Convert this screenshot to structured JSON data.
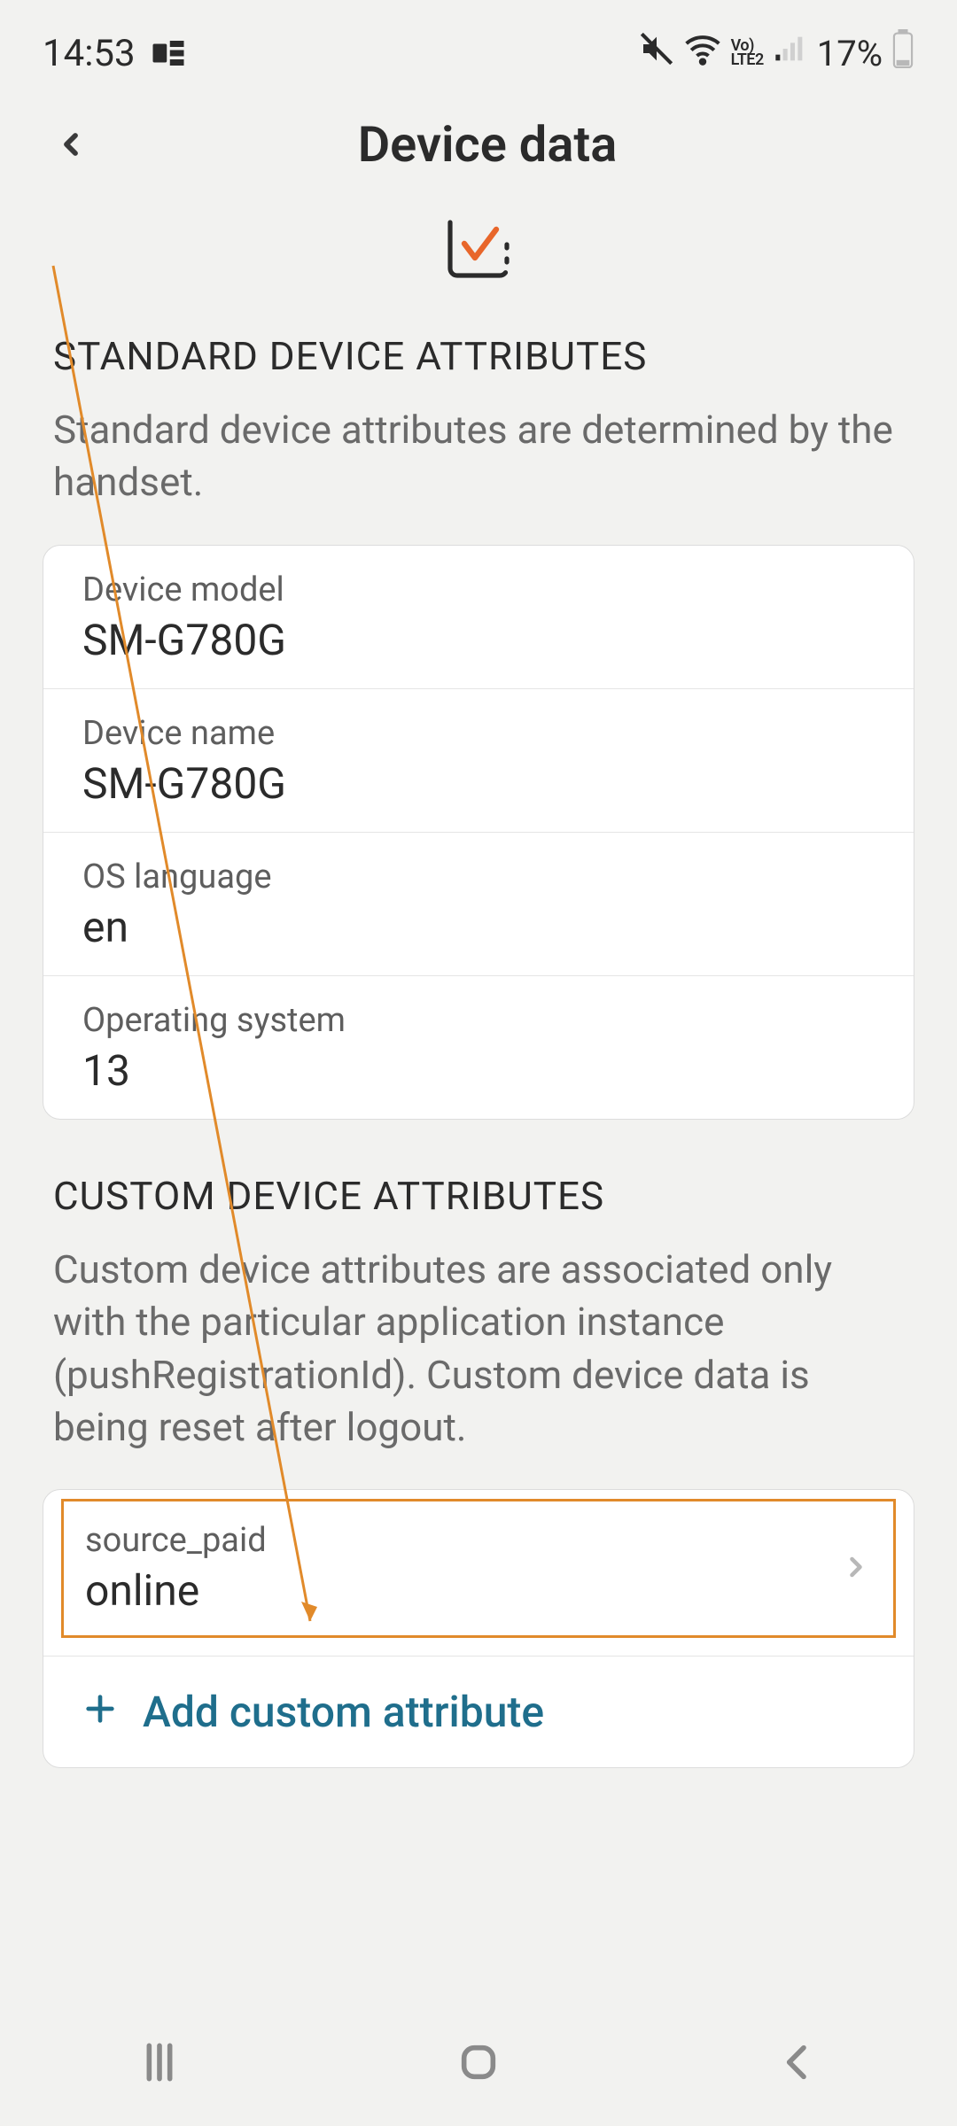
{
  "status": {
    "time": "14:53",
    "battery_text": "17%"
  },
  "header": {
    "title": "Device data"
  },
  "standard": {
    "title": "STANDARD DEVICE ATTRIBUTES",
    "desc": "Standard device attributes are determined by the handset.",
    "rows": [
      {
        "label": "Device model",
        "value": "SM-G780G"
      },
      {
        "label": "Device name",
        "value": "SM-G780G"
      },
      {
        "label": "OS language",
        "value": "en"
      },
      {
        "label": "Operating system",
        "value": "13"
      }
    ]
  },
  "custom": {
    "title": "CUSTOM DEVICE ATTRIBUTES",
    "desc": "Custom device attributes are associated only with the particular application instance (pushRegistrationId). Custom device data is being reset after logout.",
    "attr": {
      "key": "source_paid",
      "value": "online"
    },
    "add_label": "Add custom attribute"
  }
}
